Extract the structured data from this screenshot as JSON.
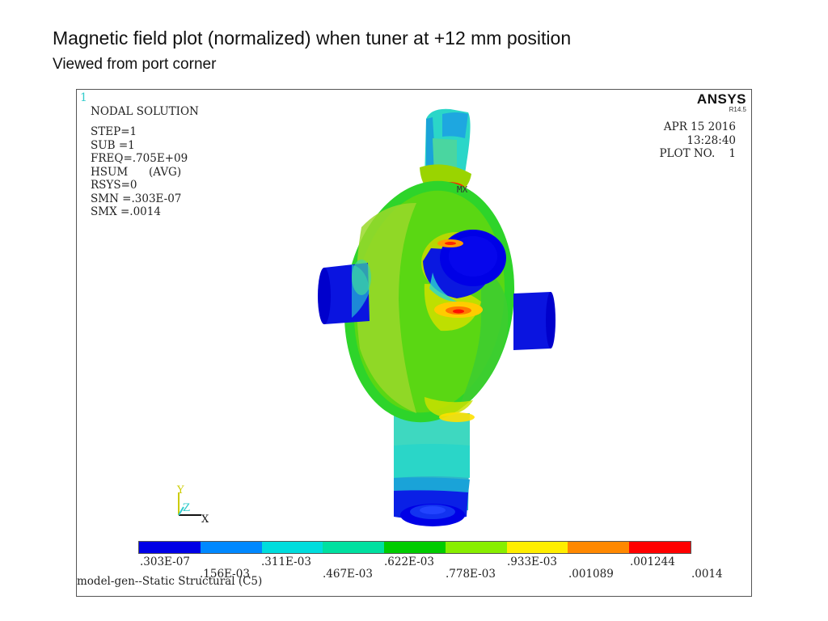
{
  "slide": {
    "title": "Magnetic field plot (normalized) when tuner at +12 mm position",
    "subtitle": "Viewed from port corner"
  },
  "plot": {
    "window_number": "1",
    "solution_heading": "NODAL SOLUTION",
    "info_lines": [
      "STEP=1",
      "SUB =1",
      "FREQ=.705E+09",
      "HSUM      (AVG)",
      "RSYS=0",
      "SMN =.303E-07",
      "SMX =.0014"
    ],
    "logo": "ANSYS",
    "version": "R14.5",
    "date": "APR 15 2016",
    "time": "13:28:40",
    "plot_no": "PLOT NO.    1",
    "max_marker": "MX",
    "triad": {
      "y": "Y",
      "z": "Z",
      "x": "X"
    },
    "model_caption": "model-gen--Static Structural (C5)",
    "colorbar": {
      "colors": [
        "#0000e6",
        "#0088ff",
        "#00dddd",
        "#00e0a0",
        "#00cc00",
        "#88ee00",
        "#ffee00",
        "#ff8800",
        "#ff0000"
      ],
      "top_labels": [
        ".303E-07",
        ".311E-03",
        ".622E-03",
        ".933E-03",
        ".001244"
      ],
      "bottom_labels": [
        ".156E-03",
        ".467E-03",
        ".778E-03",
        ".001089",
        ".0014"
      ]
    }
  }
}
